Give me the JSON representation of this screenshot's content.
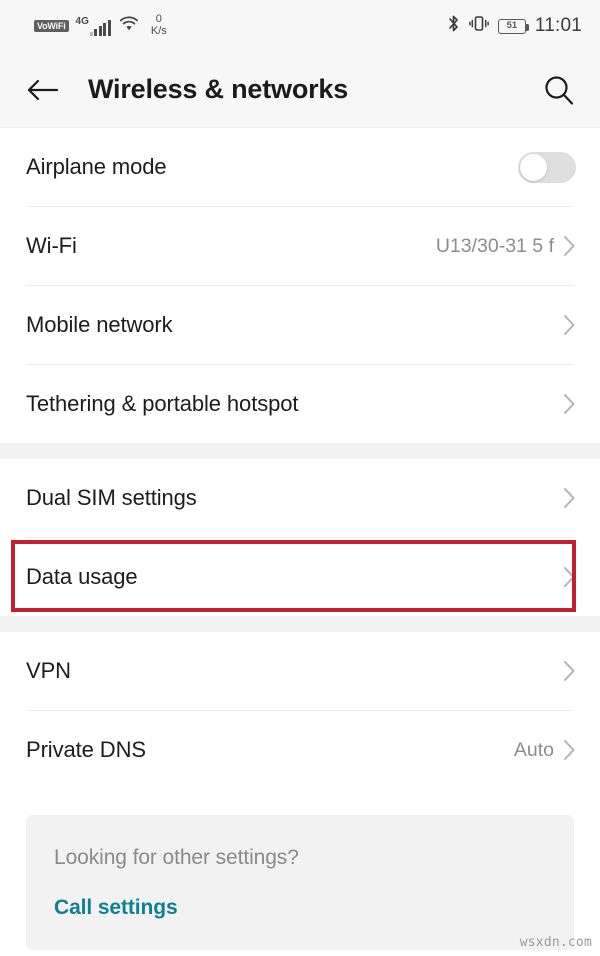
{
  "status_bar": {
    "vowifi_badge": "VoWiFi",
    "network_type": "4G",
    "signal_bars": 5,
    "wifi_icon": "wifi-icon",
    "data_speed_value": "0",
    "data_speed_unit": "K/s",
    "bluetooth_icon": "bluetooth-icon",
    "vibrate_icon": "vibrate-icon",
    "battery_percent": "51",
    "time": "11:01"
  },
  "app_bar": {
    "back_icon": "back-arrow-icon",
    "title": "Wireless & networks",
    "search_icon": "search-icon"
  },
  "sections": [
    {
      "rows": [
        {
          "label": "Airplane mode",
          "control": "toggle",
          "toggle_on": false
        },
        {
          "label": "Wi-Fi",
          "value": "U13/30-31 5 f",
          "control": "chevron"
        },
        {
          "label": "Mobile network",
          "value": "",
          "control": "chevron"
        },
        {
          "label": "Tethering & portable hotspot",
          "value": "",
          "control": "chevron"
        }
      ]
    },
    {
      "rows": [
        {
          "label": "Dual SIM settings",
          "value": "",
          "control": "chevron"
        },
        {
          "label": "Data usage",
          "value": "",
          "control": "chevron",
          "highlighted": true
        }
      ]
    },
    {
      "rows": [
        {
          "label": "VPN",
          "value": "",
          "control": "chevron"
        },
        {
          "label": "Private DNS",
          "value": "Auto",
          "control": "chevron"
        }
      ]
    }
  ],
  "footer_card": {
    "question": "Looking for other settings?",
    "link_label": "Call settings"
  },
  "watermark": "wsxdn.com",
  "colors": {
    "highlight_box": "#c22030",
    "link": "#0f7f93",
    "section_gap": "#f2f2f2",
    "header_bg": "#f7f7f7",
    "value_text": "#8c8c8c"
  }
}
